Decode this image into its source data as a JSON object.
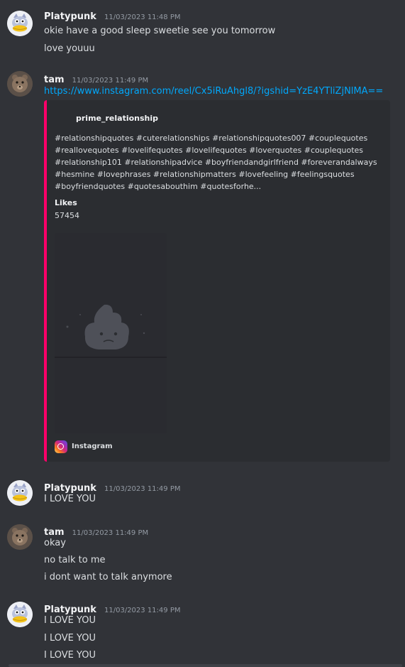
{
  "messages": [
    {
      "author": "Platypunk",
      "timestamp": "11/03/2023 11:48 PM",
      "lines": [
        "okie have a good sleep sweetie see you tomorrow",
        "love youuu"
      ]
    },
    {
      "author": "tam",
      "timestamp": "11/03/2023 11:49 PM",
      "link": "https://www.instagram.com/reel/Cx5iRuAhgl8/?igshid=YzE4YTliZjNlMA==",
      "embed": {
        "author": "prime_relationship",
        "description": "#relationshipquotes #cuterelationships #relationshipquotes007 #couplequotes #reallovequotes #lovelifequotes #lovelifequotes #loverquotes #couplequotes #relationship101 #relationshipadvice #boyfriendandgirlfriend #foreverandalways #hesmine #lovephrases #relationshipmatters #lovefeeling #feelingsquotes #boyfriendquotes #quotesabouthim #quotesforhe...",
        "field_name": "Likes",
        "field_value": "57454",
        "footer": "Instagram",
        "accent_color": "#ff0069"
      }
    },
    {
      "author": "Platypunk",
      "timestamp": "11/03/2023 11:49 PM",
      "lines": [
        "I LOVE YOU"
      ]
    },
    {
      "author": "tam",
      "timestamp": "11/03/2023 11:49 PM",
      "lines": [
        "okay",
        "no talk to me",
        "i dont want to talk anymore"
      ]
    },
    {
      "author": "Platypunk",
      "timestamp": "11/03/2023 11:49 PM",
      "lines": [
        "I LOVE YOU",
        "I LOVE YOU",
        "I LOVE YOU"
      ]
    }
  ],
  "colors": {
    "background": "#313338",
    "link": "#00a8fc",
    "embed_background": "#2b2d31"
  }
}
